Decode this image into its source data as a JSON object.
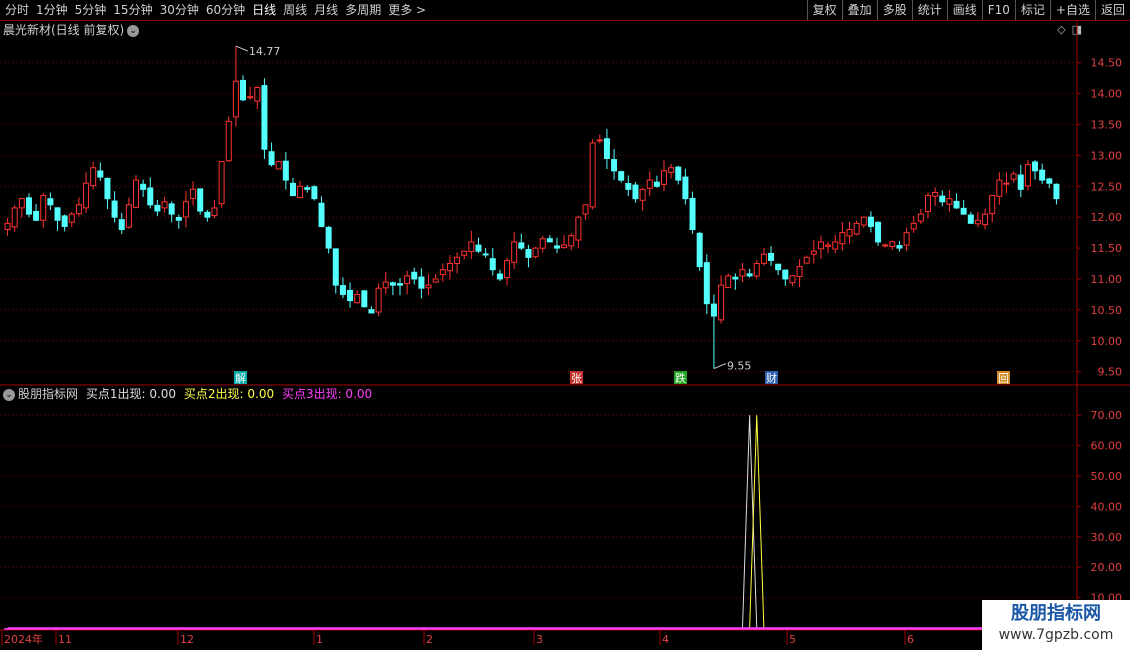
{
  "toolbar": {
    "periods": [
      "分时",
      "1分钟",
      "5分钟",
      "15分钟",
      "30分钟",
      "60分钟",
      "日线",
      "周线",
      "月线",
      "多周期",
      "更多 >"
    ],
    "actions": [
      "复权",
      "叠加",
      "多股",
      "统计",
      "画线",
      "F10",
      "标记",
      "+自选",
      "返回"
    ]
  },
  "main": {
    "title": "晨光新材(日线 前复权)",
    "max_label": "14.77",
    "min_label": "9.55",
    "events": [
      {
        "label": "解",
        "color": "#00a8a8"
      },
      {
        "label": "张",
        "color": "#c0302a"
      },
      {
        "label": "跌",
        "color": "#20a020"
      },
      {
        "label": "财",
        "color": "#2a5fb0"
      },
      {
        "label": "回",
        "color": "#d08a20"
      }
    ],
    "y_ticks": [
      "14.50",
      "14.00",
      "13.50",
      "13.00",
      "12.50",
      "12.00",
      "11.50",
      "11.00",
      "10.50",
      "10.00",
      "9.50"
    ]
  },
  "indicator": {
    "name": "股朋指标网",
    "items": [
      {
        "label": "买点1出现: 0.00",
        "color": "#dddddd"
      },
      {
        "label": "买点2出现: 0.00",
        "color": "#ffff40"
      },
      {
        "label": "买点3出现: 0.00",
        "color": "#ff40ff"
      }
    ],
    "y_ticks": [
      "70.00",
      "60.00",
      "50.00",
      "40.00",
      "30.00",
      "20.00",
      "10.00"
    ]
  },
  "x_axis": [
    "2024年",
    "11",
    "12",
    "1",
    "2",
    "3",
    "4",
    "5",
    "6"
  ],
  "watermark": {
    "line1": "股朋指标网",
    "line2": "www.7gpzb.com"
  },
  "colors": {
    "up": "#ff3232",
    "down": "#54ffff",
    "grid": "#7a0000",
    "axis": "#a00000"
  },
  "chart_data": [
    {
      "type": "candlestick",
      "title": "晨光新材(日线 前复权)",
      "ylim": [
        9.3,
        14.9
      ],
      "annotations": [
        {
          "text": "14.77",
          "value": 14.77
        },
        {
          "text": "9.55",
          "value": 9.55
        }
      ],
      "closes": [
        11.9,
        12.15,
        12.3,
        12.05,
        11.95,
        12.35,
        12.2,
        11.95,
        11.85,
        12.05,
        12.2,
        12.55,
        12.8,
        12.65,
        12.3,
        12.0,
        11.8,
        12.2,
        12.6,
        12.45,
        12.2,
        12.1,
        12.25,
        12.05,
        11.95,
        12.25,
        12.45,
        12.1,
        12.0,
        12.15,
        12.9,
        13.55,
        14.2,
        13.9,
        13.95,
        14.1,
        13.1,
        12.85,
        12.9,
        12.6,
        12.35,
        12.5,
        12.45,
        12.3,
        11.85,
        11.5,
        10.9,
        10.75,
        10.65,
        10.75,
        10.55,
        10.45,
        10.85,
        10.95,
        10.9,
        10.9,
        11.05,
        11.0,
        10.85,
        10.9,
        11.0,
        11.15,
        11.25,
        11.35,
        11.45,
        11.6,
        11.45,
        11.4,
        11.15,
        11.0,
        11.3,
        11.6,
        11.5,
        11.35,
        11.5,
        11.65,
        11.6,
        11.5,
        11.55,
        11.7,
        12.0,
        12.2,
        13.2,
        13.25,
        12.95,
        12.75,
        12.6,
        12.45,
        12.3,
        12.45,
        12.6,
        12.5,
        12.75,
        12.8,
        12.6,
        12.3,
        11.8,
        11.2,
        10.6,
        10.4,
        10.9,
        11.05,
        11.0,
        11.15,
        11.05,
        11.25,
        11.4,
        11.3,
        11.15,
        11.0,
        11.05,
        11.2,
        11.35,
        11.45,
        11.6,
        11.55,
        11.6,
        11.75,
        11.8,
        11.9,
        12.0,
        11.85,
        11.6,
        11.55,
        11.6,
        11.5,
        11.75,
        11.9,
        12.05,
        12.35,
        12.4,
        12.25,
        12.3,
        12.15,
        12.05,
        11.9,
        11.95,
        12.05,
        12.35,
        12.6,
        12.55,
        12.7,
        12.45,
        12.85,
        12.75,
        12.6,
        12.55,
        12.3
      ],
      "yticks": [
        14.5,
        14.0,
        13.5,
        13.0,
        12.5,
        12.0,
        11.5,
        11.0,
        10.5,
        10.0,
        9.5
      ]
    },
    {
      "type": "line",
      "title": "股朋指标网",
      "ylim": [
        0,
        75
      ],
      "series": [
        {
          "name": "买点1出现",
          "color": "#dddddd",
          "spike_index": 104,
          "peak": 70
        },
        {
          "name": "买点2出现",
          "color": "#ffff40",
          "spike_index": 105,
          "peak": 70
        },
        {
          "name": "买点3出现",
          "color": "#ff40ff",
          "spike_index": -1,
          "peak": 0
        }
      ],
      "yticks": [
        70,
        60,
        50,
        40,
        30,
        20,
        10
      ]
    }
  ]
}
